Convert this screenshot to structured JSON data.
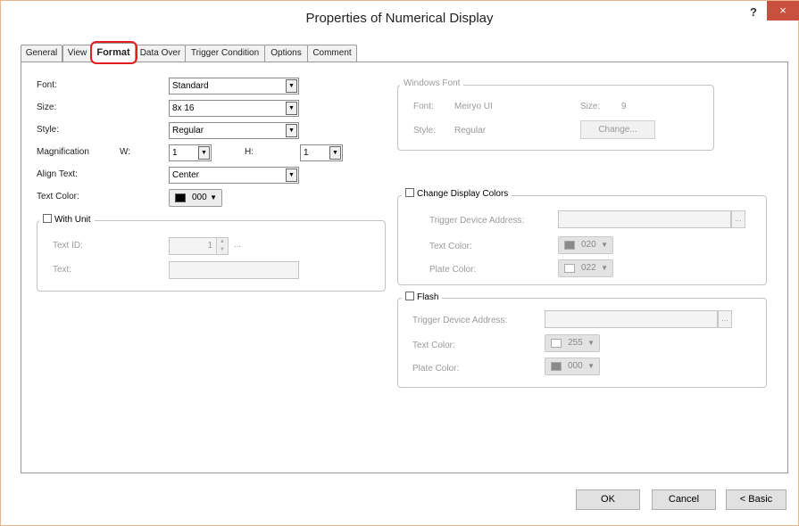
{
  "window": {
    "title": "Properties of Numerical Display",
    "help_label": "?",
    "close_label": "×"
  },
  "tabs": [
    "General",
    "View",
    "Format",
    "Data Over",
    "Trigger Condition",
    "Options",
    "Comment"
  ],
  "format": {
    "font_label": "Font:",
    "font_value": "Standard",
    "size_label": "Size:",
    "size_value": "8x 16",
    "style_label": "Style:",
    "style_value": "Regular",
    "magnification_label": "Magnification",
    "w_label": "W:",
    "w_value": "1",
    "h_label": "H:",
    "h_value": "1",
    "align_label": "Align Text:",
    "align_value": "Center",
    "text_color_label": "Text Color:",
    "text_color_value": "000",
    "text_color_swatch": "#000000"
  },
  "with_unit": {
    "label": "With Unit",
    "text_id_label": "Text ID:",
    "text_id_value": "1",
    "text_label": "Text:",
    "text_value": ""
  },
  "windows_font": {
    "title": "Windows Font",
    "font_label": "Font:",
    "font_value": "Meiryo UI",
    "size_label": "Size:",
    "size_value": "9",
    "style_label": "Style:",
    "style_value": "Regular",
    "change_button": "Change..."
  },
  "change_display_colors": {
    "label": "Change Display Colors",
    "trigger_label": "Trigger Device Address:",
    "trigger_value": "",
    "text_color_label": "Text Color:",
    "text_color_value": "020",
    "text_color_swatch": "#8a8a8a",
    "plate_color_label": "Plate Color:",
    "plate_color_value": "022",
    "plate_color_swatch": "#ffffff"
  },
  "flash": {
    "label": "Flash",
    "trigger_label": "Trigger Device Address:",
    "trigger_value": "",
    "text_color_label": "Text Color:",
    "text_color_value": "255",
    "text_color_swatch": "#ffffff",
    "plate_color_label": "Plate Color:",
    "plate_color_value": "000",
    "plate_color_swatch": "#8a8a8a"
  },
  "ellipsis": "...",
  "footer": {
    "ok": "OK",
    "cancel": "Cancel",
    "basic": "< Basic"
  }
}
